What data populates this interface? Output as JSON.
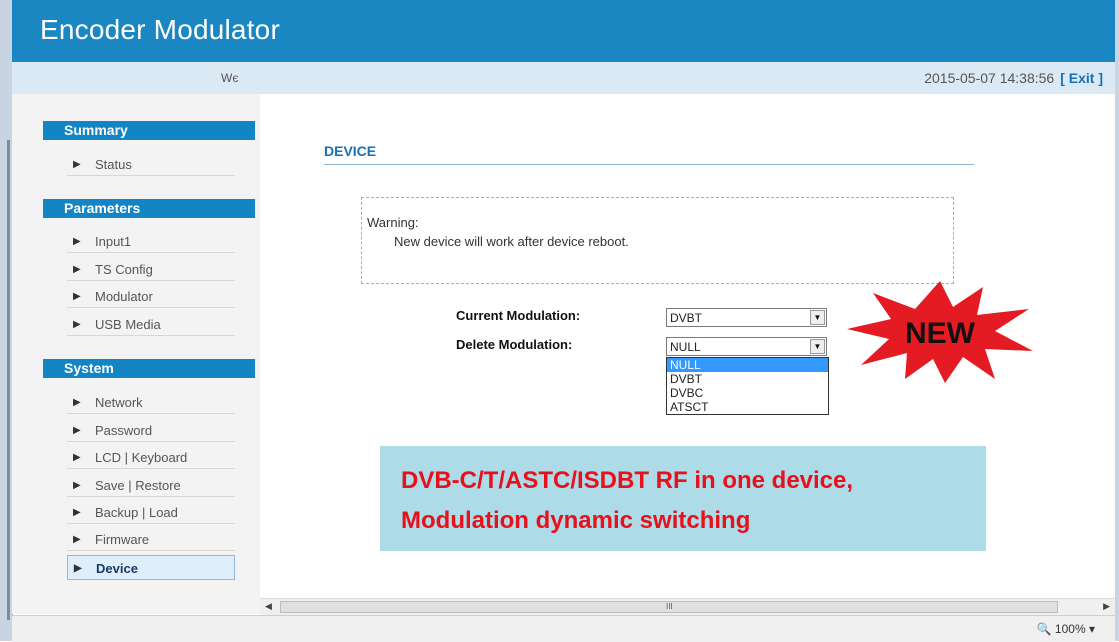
{
  "header": {
    "title": "Encoder Modulator"
  },
  "subbar": {
    "welcome": "Wє",
    "datetime": "2015-05-07 14:38:56",
    "exit_label": "[ Exit ]"
  },
  "sidebar": {
    "sections": [
      {
        "title": "Summary",
        "items": [
          "Status"
        ]
      },
      {
        "title": "Parameters",
        "items": [
          "Input1",
          "TS Config",
          "Modulator",
          "USB Media"
        ]
      },
      {
        "title": "System",
        "items": [
          "Network",
          "Password",
          "LCD | Keyboard",
          "Save | Restore",
          "Backup | Load",
          "Firmware",
          "Device"
        ]
      }
    ],
    "active_item": "Device",
    "arrow_glyph": "▶"
  },
  "main": {
    "title": "DEVICE",
    "warning": {
      "title": "Warning:",
      "message": "New device will work after device reboot."
    },
    "current_modulation": {
      "label": "Current Modulation:",
      "value": "DVBT"
    },
    "delete_modulation": {
      "label": "Delete Modulation:",
      "value": "NULL",
      "options": [
        "NULL",
        "DVBT",
        "DVBC",
        "ATSCT"
      ],
      "selected_option": "NULL"
    },
    "new_badge": {
      "text": "NEW",
      "color": "#e41b23"
    },
    "promo": {
      "line1": "DVB-C/T/ASTC/ISDBT RF in one device,",
      "line2": "Modulation dynamic switching"
    }
  },
  "scrollbar": {
    "grip": "III"
  },
  "statusbar": {
    "zoom": "100%"
  },
  "colors": {
    "header": "#1a86c2",
    "section": "#1485c4",
    "accent_text": "#1a6fb3",
    "promo_bg": "#addbe8",
    "promo_text": "#e8101b"
  }
}
